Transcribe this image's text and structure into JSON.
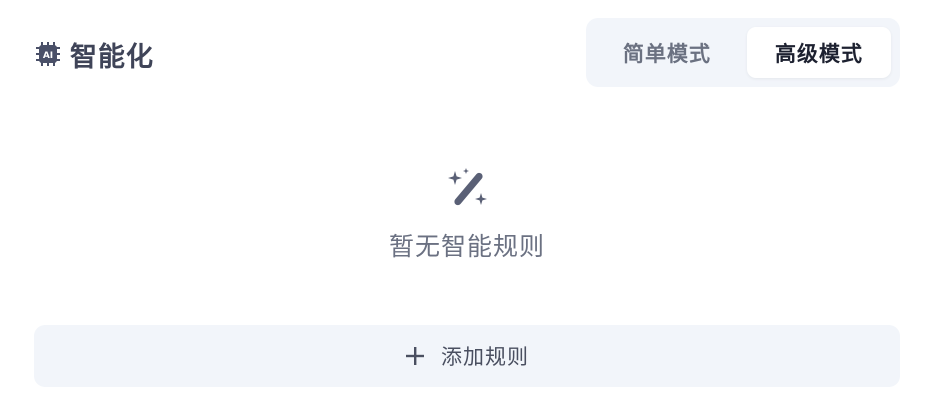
{
  "header": {
    "title": "智能化",
    "icon": "ai-chip-icon",
    "icon_text": "AI"
  },
  "mode_toggle": {
    "options": [
      {
        "label": "简单模式",
        "active": false
      },
      {
        "label": "高级模式",
        "active": true
      }
    ]
  },
  "empty_state": {
    "icon": "magic-wand-icon",
    "text": "暂无智能规则"
  },
  "add_rule": {
    "icon": "plus-icon",
    "label": "添加规则"
  },
  "colors": {
    "title": "#3f4458",
    "muted_text": "#6b7182",
    "toggle_bg": "#f2f5fa",
    "active_bg": "#ffffff",
    "active_text": "#1d2130",
    "icon": "#5a6076"
  }
}
